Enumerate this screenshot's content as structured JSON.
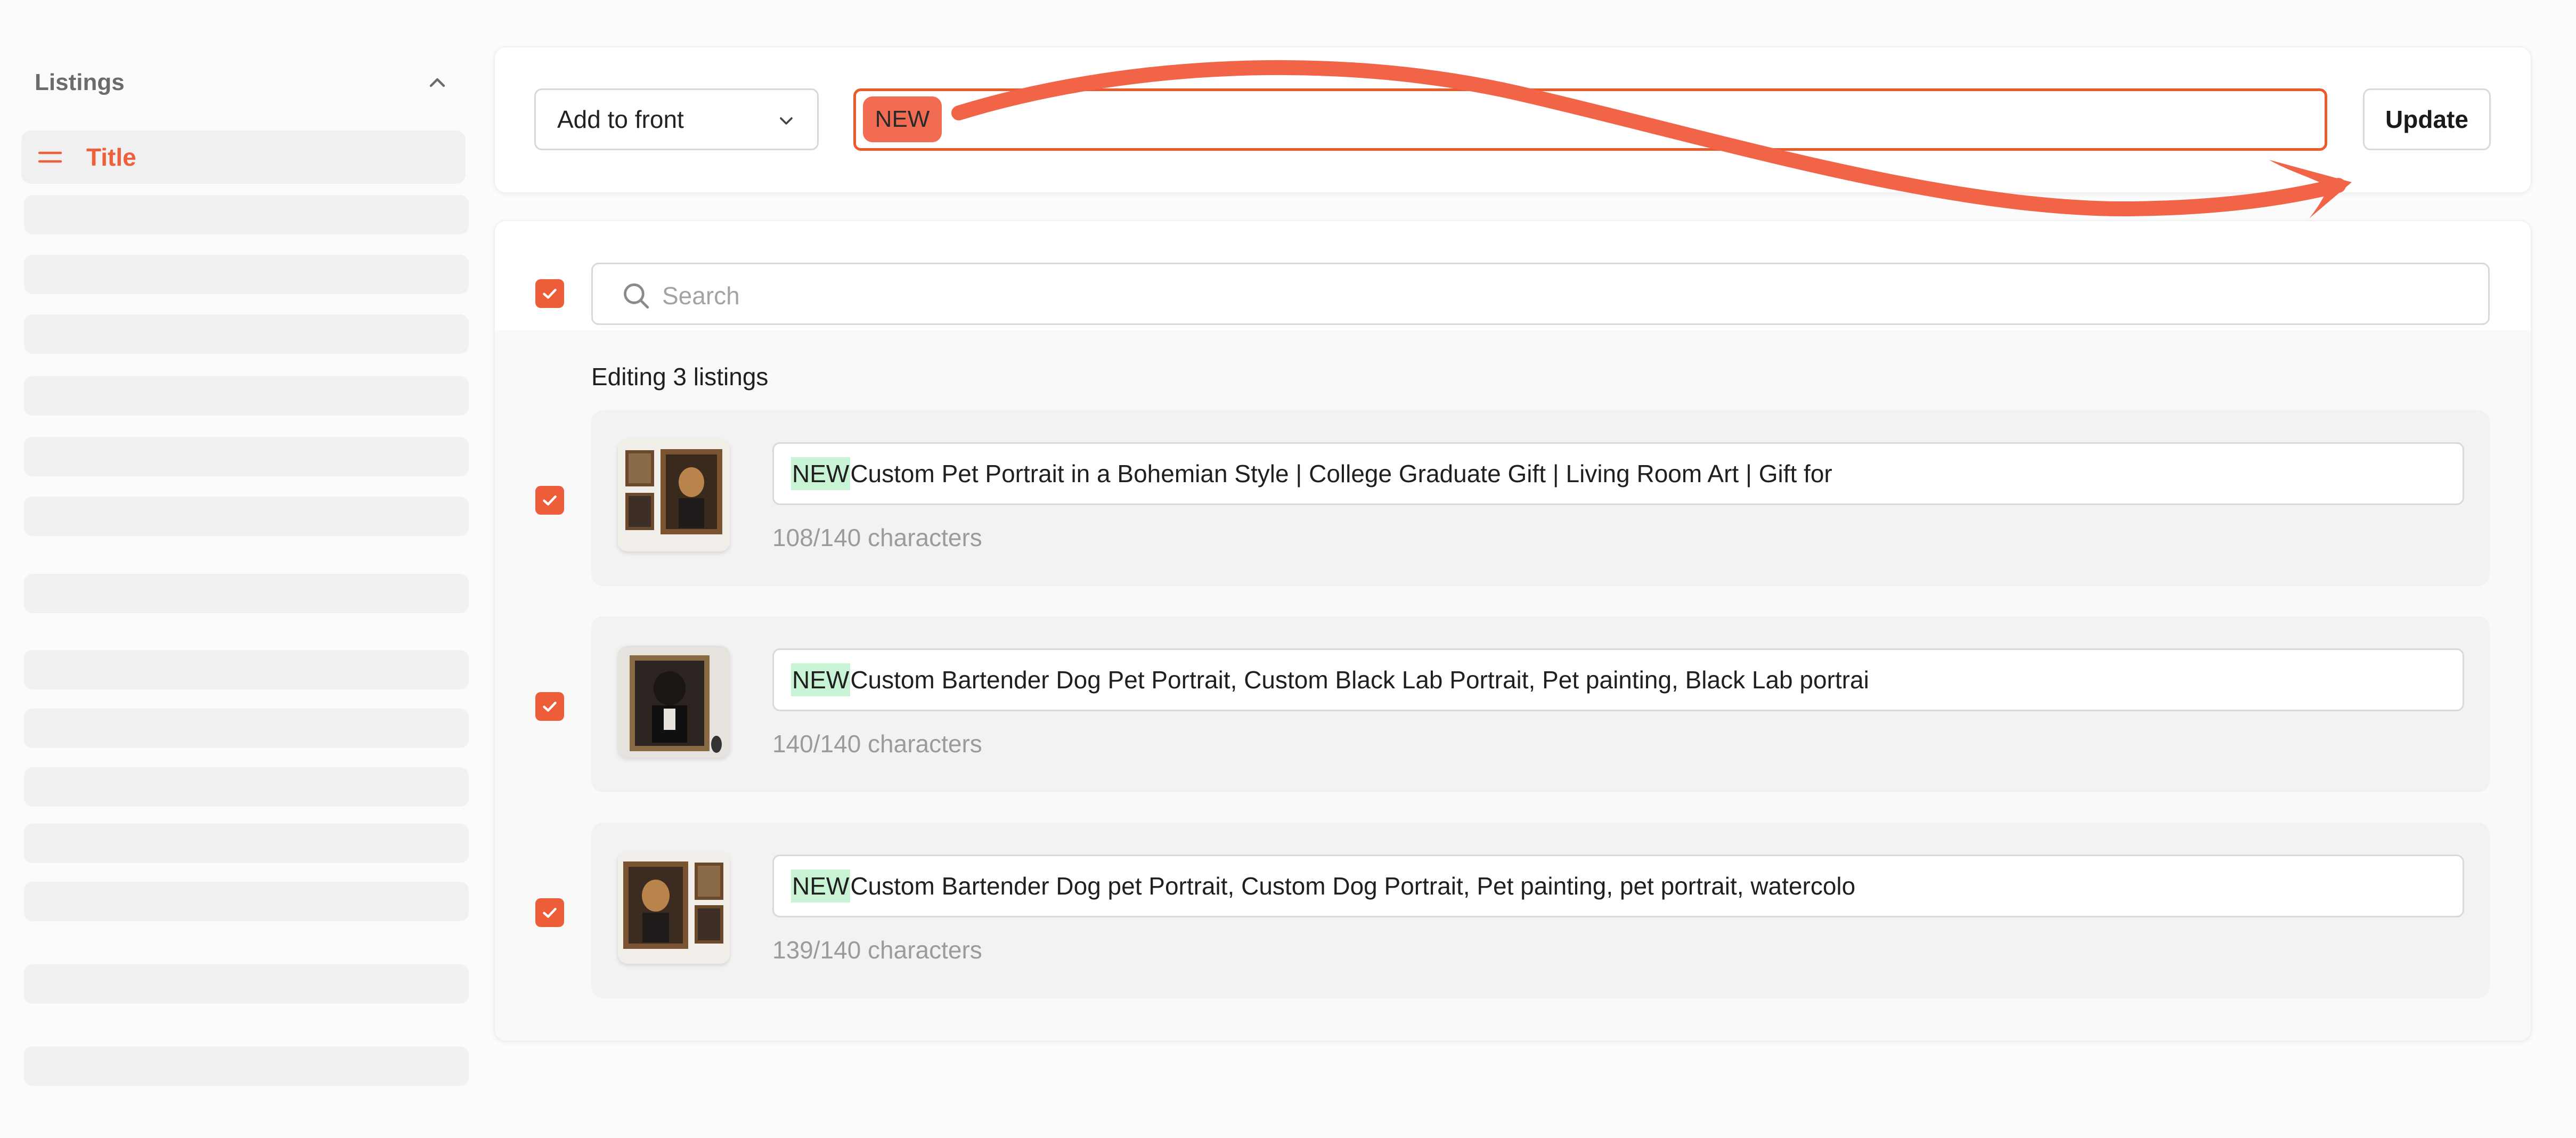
{
  "sidebar": {
    "title": "Listings",
    "active_item": "Title"
  },
  "toolbar": {
    "mode": "Add to front",
    "input_chip": "NEW",
    "update_label": "Update"
  },
  "search": {
    "placeholder": "Search"
  },
  "editing_text": "Editing 3 listings",
  "listings": [
    {
      "prefix": "NEW",
      "title": " Custom Pet Portrait in a Bohemian Style | College Graduate Gift | Living Room Art | Gift for",
      "count": "108/140 characters"
    },
    {
      "prefix": "NEW",
      "title": " Custom Bartender Dog Pet Portrait, Custom Black Lab Portrait, Pet painting, Black Lab portrai",
      "count": "140/140 characters"
    },
    {
      "prefix": "NEW",
      "title": " Custom Bartender Dog pet Portrait, Custom Dog Portrait, Pet painting, pet portrait, watercolo",
      "count": "139/140 characters"
    }
  ],
  "colors": {
    "accent": "#ee5d3a",
    "highlight": "#c8f3d4",
    "chip": "#f26c53"
  }
}
